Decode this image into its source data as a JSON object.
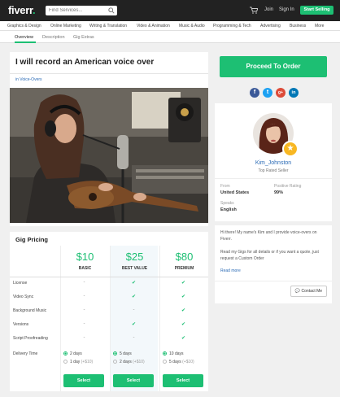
{
  "header": {
    "logo": "fiverr",
    "search_placeholder": "Find Services...",
    "join": "Join",
    "sign_in": "Sign In",
    "start_selling": "Start Selling"
  },
  "categories": [
    "Graphics & Design",
    "Online Marketing",
    "Writing & Translation",
    "Video & Animation",
    "Music & Audio",
    "Programming & Tech",
    "Advertising",
    "Business",
    "More"
  ],
  "tabs": [
    "Overview",
    "Description",
    "Gig Extras"
  ],
  "gig": {
    "title": "I will record an American voice over",
    "breadcrumb": "in Voice-Overs"
  },
  "pricing": {
    "title": "Gig Pricing",
    "packages": [
      {
        "price": "$10",
        "name": "BASIC"
      },
      {
        "price": "$25",
        "name": "BEST VALUE"
      },
      {
        "price": "$80",
        "name": "PREMIUM"
      }
    ],
    "features": [
      {
        "name": "License",
        "values": [
          "-",
          "check",
          "check"
        ]
      },
      {
        "name": "Video Sync",
        "values": [
          "-",
          "check",
          "check"
        ]
      },
      {
        "name": "Background Music",
        "values": [
          "-",
          "-",
          "check"
        ]
      },
      {
        "name": "Versions",
        "values": [
          "-",
          "check",
          "check"
        ]
      },
      {
        "name": "Script Proofreading",
        "values": [
          "-",
          "-",
          "check"
        ]
      }
    ],
    "delivery_label": "Delivery Time",
    "delivery": [
      {
        "opt1": "2 days",
        "opt2_days": "1 day",
        "opt2_extra": "(+$10)"
      },
      {
        "opt1": "5 days",
        "opt2_days": "2 days",
        "opt2_extra": "(+$10)"
      },
      {
        "opt1": "10 days",
        "opt2_days": "5 days",
        "opt2_extra": "(+$10)"
      }
    ],
    "select_label": "Select"
  },
  "order_button": "Proceed To Order",
  "share_icons": [
    "facebook-icon",
    "twitter-icon",
    "google-plus-icon",
    "linkedin-icon"
  ],
  "seller": {
    "name": "Kim_Johnston",
    "level": "Top Rated Seller",
    "from_label": "From",
    "from_value": "United States",
    "rating_label": "Positive Rating",
    "rating_value": "99%",
    "speaks_label": "Speaks",
    "speaks_value": "English"
  },
  "about": {
    "text1": "Hi there! My name's Kim and I provide voice-overs on Fiverr.",
    "text2": "Read my Gigs for all details or if you want a quote, just request a Custom Order",
    "read_more": "Read more",
    "contact": "Contact Me"
  },
  "colors": {
    "accent": "#1dbf73",
    "link": "#2a6ab5",
    "header_bg": "#222222",
    "badge": "#f8b722"
  }
}
